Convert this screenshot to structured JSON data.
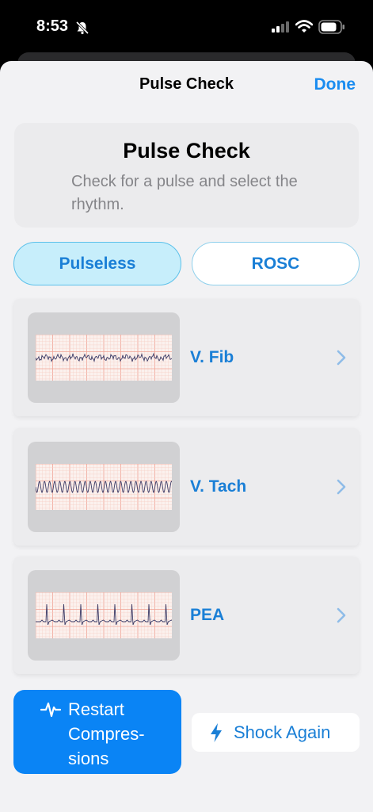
{
  "status": {
    "time": "8:53"
  },
  "nav": {
    "title": "Pulse Check",
    "done_label": "Done"
  },
  "info": {
    "title": "Pulse Check",
    "description": "Check for a pulse and select the rhythm."
  },
  "segments": [
    {
      "label": "Pulseless",
      "selected": true
    },
    {
      "label": "ROSC",
      "selected": false
    }
  ],
  "rhythms": [
    {
      "label": "V. Fib",
      "waveform": "vfib"
    },
    {
      "label": "V. Tach",
      "waveform": "vtach"
    },
    {
      "label": "PEA",
      "waveform": "pea"
    }
  ],
  "actions": {
    "restart_label": "Restart Compres-sions",
    "shock_label": "Shock Again"
  },
  "colors": {
    "accent": "#1a7fd6",
    "primary_button": "#0a84f5",
    "selected_segment": "#c7eefb"
  }
}
